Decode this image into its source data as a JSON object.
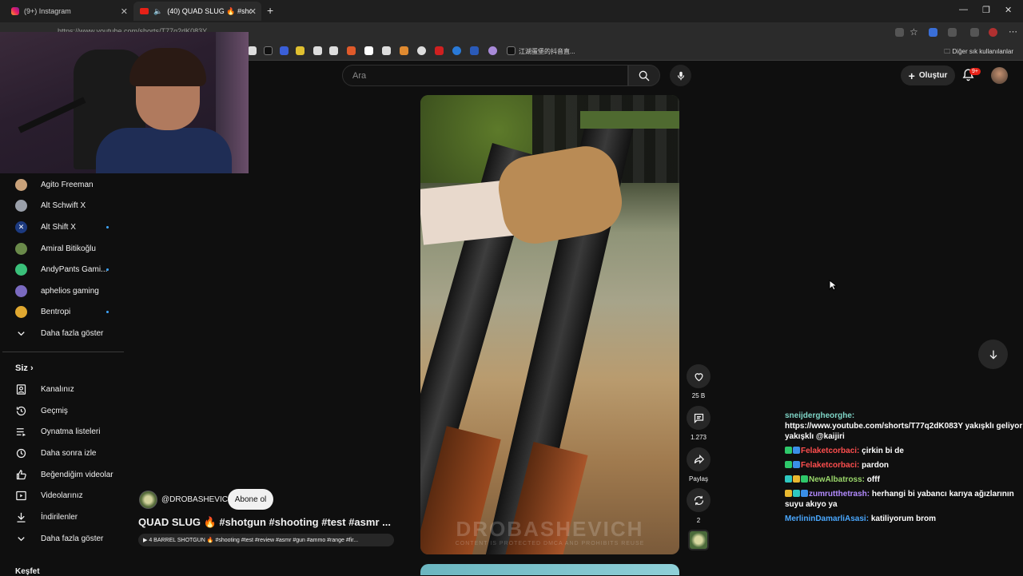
{
  "browser": {
    "tabs": [
      {
        "label": "(9+) Instagram",
        "active": false
      },
      {
        "label": "(40) QUAD SLUG 🔥 #shotgu",
        "active": true
      }
    ],
    "url": "https://www.youtube.com/shorts/T77q2dK083Y",
    "bookmark_text": "江湖蛋堡的抖音直...",
    "other_bookmarks": "Diğer sık kullanılanlar"
  },
  "header": {
    "search_placeholder": "Ara",
    "create_label": "Oluştur",
    "notification_count": "9+"
  },
  "sidebar": {
    "subscriptions": [
      {
        "label": "Agito Freeman",
        "new": false,
        "color": "#c9a27a"
      },
      {
        "label": "Alt Schwift X",
        "new": false,
        "color": "#9aa0aa"
      },
      {
        "label": "Alt Shift X",
        "new": true,
        "color": "#3a6fd8"
      },
      {
        "label": "Amiral Bitikoğlu",
        "new": false,
        "color": "#6a8a4a"
      },
      {
        "label": "AndyPants Gami...",
        "new": true,
        "color": "#3ac07a"
      },
      {
        "label": "aphelios gaming",
        "new": false,
        "color": "#7a6ac0"
      },
      {
        "label": "Bentropi",
        "new": true,
        "color": "#e0a830"
      }
    ],
    "show_more_1": "Daha fazla göster",
    "you_section": "Siz",
    "you_items": [
      {
        "label": "Kanalınız",
        "icon": "channel-icon"
      },
      {
        "label": "Geçmiş",
        "icon": "history-icon"
      },
      {
        "label": "Oynatma listeleri",
        "icon": "playlists-icon"
      },
      {
        "label": "Daha sonra izle",
        "icon": "clock-icon"
      },
      {
        "label": "Beğendiğim videolar",
        "icon": "thumbs-up-icon"
      },
      {
        "label": "Videolarınız",
        "icon": "video-icon"
      },
      {
        "label": "İndirilenler",
        "icon": "download-icon"
      }
    ],
    "show_more_2": "Daha fazla göster",
    "explore_section": "Keşfet"
  },
  "video": {
    "watermark": "DROBASHEVICH",
    "watermark_sub": "CONTENT IS PROTECTED DMCA AND PROHIBITS REUSE",
    "channel": "@DROBASHEVICH",
    "subscribe_label": "Abone ol",
    "title": "QUAD SLUG 🔥 #shotgun #shooting #test #asmr ...",
    "sound": "▶ 4 BARREL SHOTGUN 🔥 #shooting #test #review #asmr #gun #ammo #range #fir..."
  },
  "actions": {
    "likes": "25 B",
    "comments": "1.273",
    "share": "Paylaş",
    "remix": "2"
  },
  "chat": [
    {
      "user": "sneijdergheorghe:",
      "text": "https://www.youtube.com/shorts/T77q2dK083Y yakışklı geliyor yakışklı @kaijiri",
      "cls": "u1"
    },
    {
      "user": "Felaketcorbaci:",
      "text": "çirkin bi de",
      "cls": "u2"
    },
    {
      "user": "Felaketcorbaci:",
      "text": "pardon",
      "cls": "u2"
    },
    {
      "user": "NewAlbatross:",
      "text": "offf",
      "cls": "u3"
    },
    {
      "user": "zumrutthetrash:",
      "text": "herhangi bi yabancı karıya ağızlarının suyu akıyo ya",
      "cls": "u4"
    },
    {
      "user": "MerlininDamarliAsasi:",
      "text": "katiliyorum brom",
      "cls": "u5"
    }
  ],
  "colors": {
    "background": "#0f0f0f",
    "accent_red": "#e62117",
    "link_blue": "#3ea6ff"
  }
}
